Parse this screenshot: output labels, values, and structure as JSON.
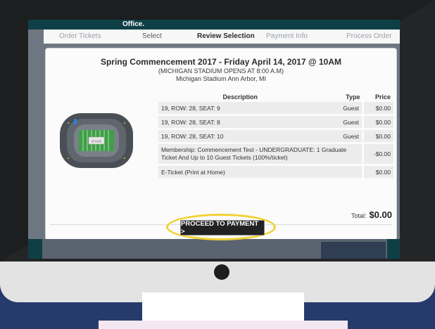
{
  "header": {
    "office_text": "Office."
  },
  "steps": [
    {
      "label": "Order Tickets",
      "state": "dim"
    },
    {
      "label": "Select",
      "state": "normal"
    },
    {
      "label": "Review Selection",
      "state": "active"
    },
    {
      "label": "Payment Info",
      "state": "dim"
    },
    {
      "label": "Process Order",
      "state": "dim"
    }
  ],
  "event": {
    "title": "Spring Commencement 2017 - Friday April 14, 2017 @ 10AM",
    "opens": "(MICHIGAN STADIUM OPENS AT 8:00 A.M)",
    "venue": "Michigan Stadium Ann Arbor, MI"
  },
  "map": {
    "stage_label": "STAGE"
  },
  "table": {
    "headers": {
      "description": "Description",
      "type": "Type",
      "price": "Price"
    },
    "rows": [
      {
        "description": "19, ROW: 28, SEAT: 9",
        "type": "Guest",
        "price": "$0.00"
      },
      {
        "description": "19, ROW: 28, SEAT: 8",
        "type": "Guest",
        "price": "$0.00"
      },
      {
        "description": "19, ROW: 28, SEAT: 10",
        "type": "Guest",
        "price": "$0.00"
      },
      {
        "description": "Membership: Commencement Test - UNDERGRADUATE: 1 Graduate Ticket And Up to 10 Guest Tickets (100%/ticket)",
        "type": "",
        "price": "-$0.00"
      },
      {
        "description": "E-Ticket (Print at Home)",
        "type": "",
        "price": "$0.00"
      }
    ]
  },
  "total": {
    "label": "Total:",
    "value": "$0.00"
  },
  "cta": {
    "label": "PROCEED TO PAYMENT >"
  },
  "colors": {
    "highlight_ring": "#f1d232",
    "page_background": "#263a6b"
  }
}
